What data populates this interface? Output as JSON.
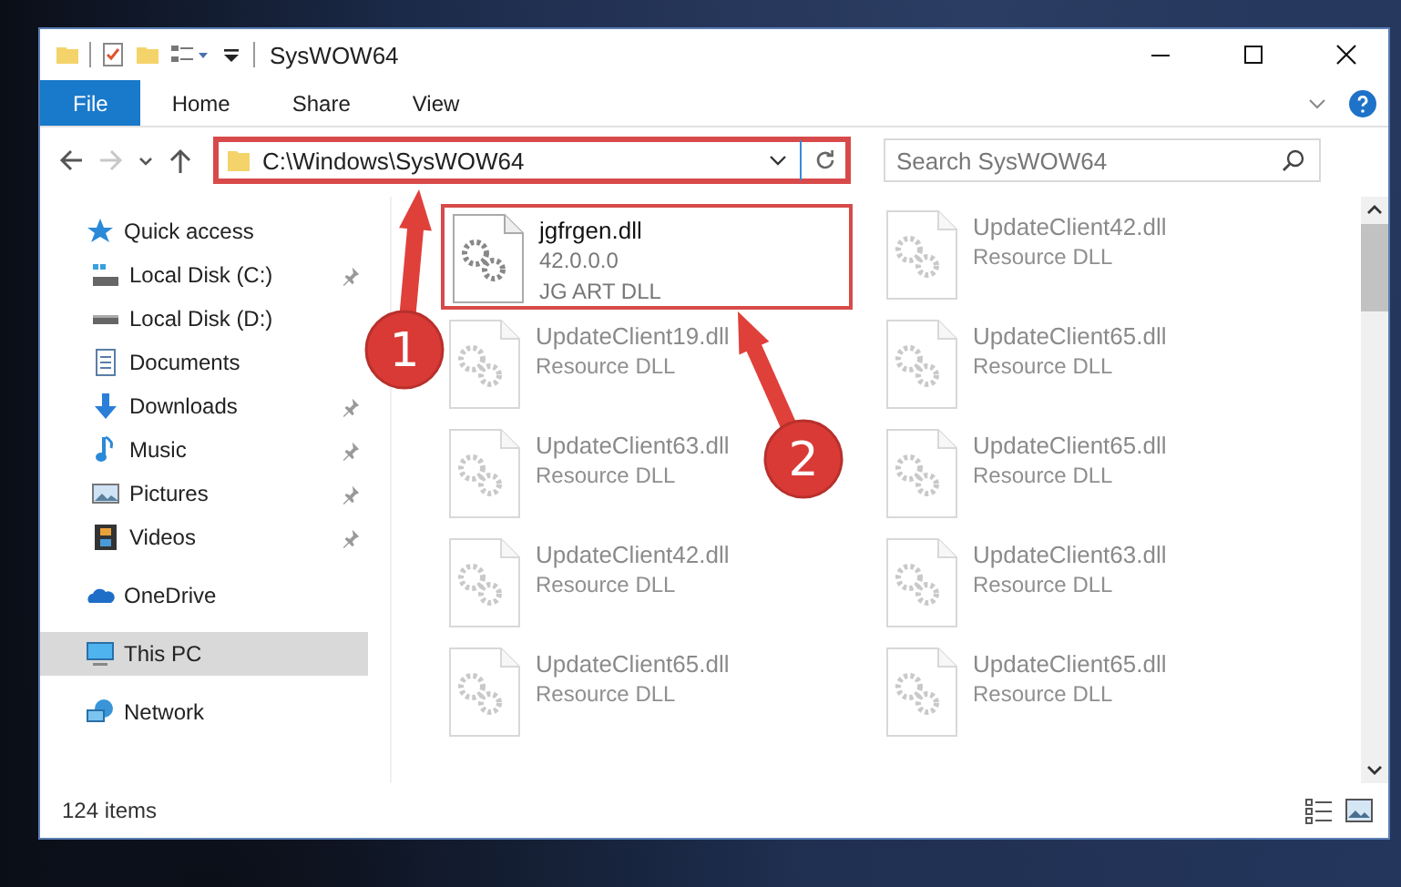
{
  "window": {
    "title": "SysWOW64"
  },
  "ribbon_tabs": [
    {
      "label": "File",
      "kind": "file",
      "selected": false
    },
    {
      "label": "Home",
      "kind": "tab",
      "selected": false
    },
    {
      "label": "Share",
      "kind": "tab",
      "selected": false
    },
    {
      "label": "View",
      "kind": "tab",
      "selected": false
    }
  ],
  "nav_buttons": [
    {
      "kind": "back",
      "disabled": false
    },
    {
      "kind": "forward",
      "disabled": true
    },
    {
      "kind": "recent",
      "disabled": false
    },
    {
      "kind": "up",
      "disabled": false
    }
  ],
  "address_bar": {
    "path": "C:\\Windows\\SysWOW64",
    "highlighted": true
  },
  "search": {
    "placeholder": "Search SysWOW64"
  },
  "sidebar": {
    "items": [
      {
        "label": "Quick access",
        "kind": "star",
        "selected": false,
        "children": [
          {
            "label": "Local Disk (C:)",
            "kind": "system-drive",
            "pinned": true,
            "selected": false
          },
          {
            "label": "Local Disk (D:)",
            "kind": "drive",
            "pinned": false,
            "selected": false
          },
          {
            "label": "Documents",
            "kind": "documents",
            "pinned": false,
            "selected": false
          },
          {
            "label": "Downloads",
            "kind": "downloads",
            "pinned": true,
            "selected": false
          },
          {
            "label": "Music",
            "kind": "music",
            "pinned": true,
            "selected": false
          },
          {
            "label": "Pictures",
            "kind": "pictures",
            "pinned": true,
            "selected": false
          },
          {
            "label": "Videos",
            "kind": "videos",
            "pinned": true,
            "selected": false
          }
        ]
      },
      {
        "label": "OneDrive",
        "kind": "cloud",
        "selected": false
      },
      {
        "label": "This PC",
        "kind": "computer",
        "selected": true
      },
      {
        "label": "Network",
        "kind": "network",
        "selected": false
      }
    ]
  },
  "files": [
    {
      "name": "jgfrgen.dll",
      "details": [
        "42.0.0.0",
        "JG ART DLL"
      ],
      "faded": false,
      "highlighted": true
    },
    {
      "name": "UpdateClient42.dll",
      "details": [
        "Resource DLL"
      ],
      "faded": true,
      "highlighted": false
    },
    {
      "name": "UpdateClient19.dll",
      "details": [
        "Resource DLL"
      ],
      "faded": true,
      "highlighted": false
    },
    {
      "name": "UpdateClient65.dll",
      "details": [
        "Resource DLL"
      ],
      "faded": true,
      "highlighted": false
    },
    {
      "name": "UpdateClient63.dll",
      "details": [
        "Resource DLL"
      ],
      "faded": true,
      "highlighted": false
    },
    {
      "name": "UpdateClient65.dll",
      "details": [
        "Resource DLL"
      ],
      "faded": true,
      "highlighted": false
    },
    {
      "name": "UpdateClient42.dll",
      "details": [
        "Resource DLL"
      ],
      "faded": true,
      "highlighted": false
    },
    {
      "name": "UpdateClient63.dll",
      "details": [
        "Resource DLL"
      ],
      "faded": true,
      "highlighted": false
    },
    {
      "name": "UpdateClient65.dll",
      "details": [
        "Resource DLL"
      ],
      "faded": true,
      "highlighted": false
    },
    {
      "name": "UpdateClient65.dll",
      "details": [
        "Resource DLL"
      ],
      "faded": true,
      "highlighted": false
    }
  ],
  "status_bar": {
    "count": "124 items"
  },
  "annotations": [
    {
      "number": "1"
    },
    {
      "number": "2"
    }
  ]
}
